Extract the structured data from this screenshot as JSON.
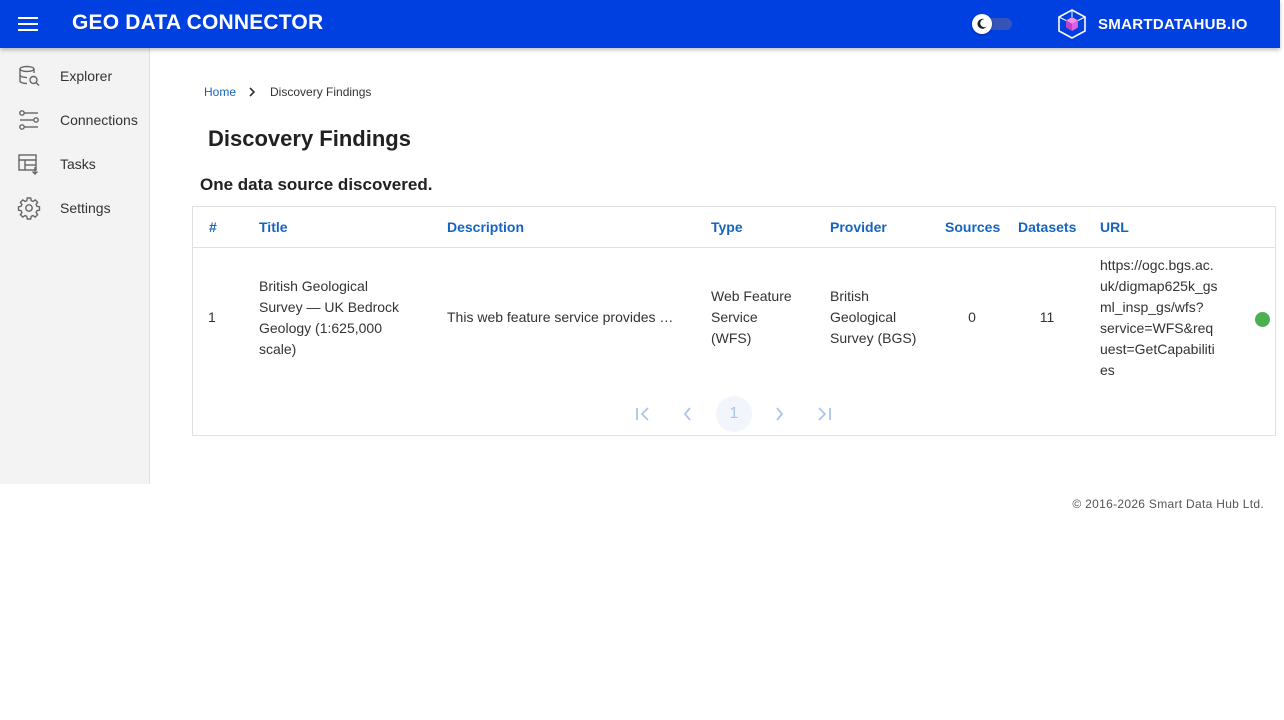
{
  "header": {
    "app_title": "GEO DATA CONNECTOR",
    "brand_name": "SMARTDATAHUB.IO",
    "color": "#0040e0"
  },
  "sidebar": {
    "items": [
      {
        "label": "Explorer",
        "icon": "database-search-icon"
      },
      {
        "label": "Connections",
        "icon": "connections-icon"
      },
      {
        "label": "Tasks",
        "icon": "tasks-icon"
      },
      {
        "label": "Settings",
        "icon": "gear-icon"
      }
    ]
  },
  "breadcrumb": {
    "home": "Home",
    "current": "Discovery Findings"
  },
  "page": {
    "title": "Discovery Findings",
    "subtitle": "One data source discovered."
  },
  "table": {
    "columns": [
      "#",
      "Title",
      "Description",
      "Type",
      "Provider",
      "Sources",
      "Datasets",
      "URL"
    ],
    "rows": [
      {
        "index": "1",
        "title_lines": [
          "British Geological",
          "Survey — UK Bedrock",
          "Geology (1:625,000",
          "scale)"
        ],
        "description": "This web feature service provides …",
        "type_lines": [
          "Web Feature",
          "Service",
          "(WFS)"
        ],
        "provider_lines": [
          "British",
          "Geological",
          "Survey (BGS)"
        ],
        "sources": "0",
        "datasets": "11",
        "url_lines": [
          "https://ogc.bgs.ac.",
          "uk/digmap625k_gs",
          "ml_insp_gs/wfs?",
          "service=WFS&req",
          "uest=GetCapabiliti",
          "es"
        ],
        "status_color": "#4caf50"
      }
    ]
  },
  "pagination": {
    "current_page": "1",
    "icons": [
      "first-page-icon",
      "prev-page-icon",
      "next-page-icon",
      "last-page-icon"
    ]
  },
  "footer": {
    "copyright": "© 2016-2026 Smart Data Hub Ltd."
  }
}
